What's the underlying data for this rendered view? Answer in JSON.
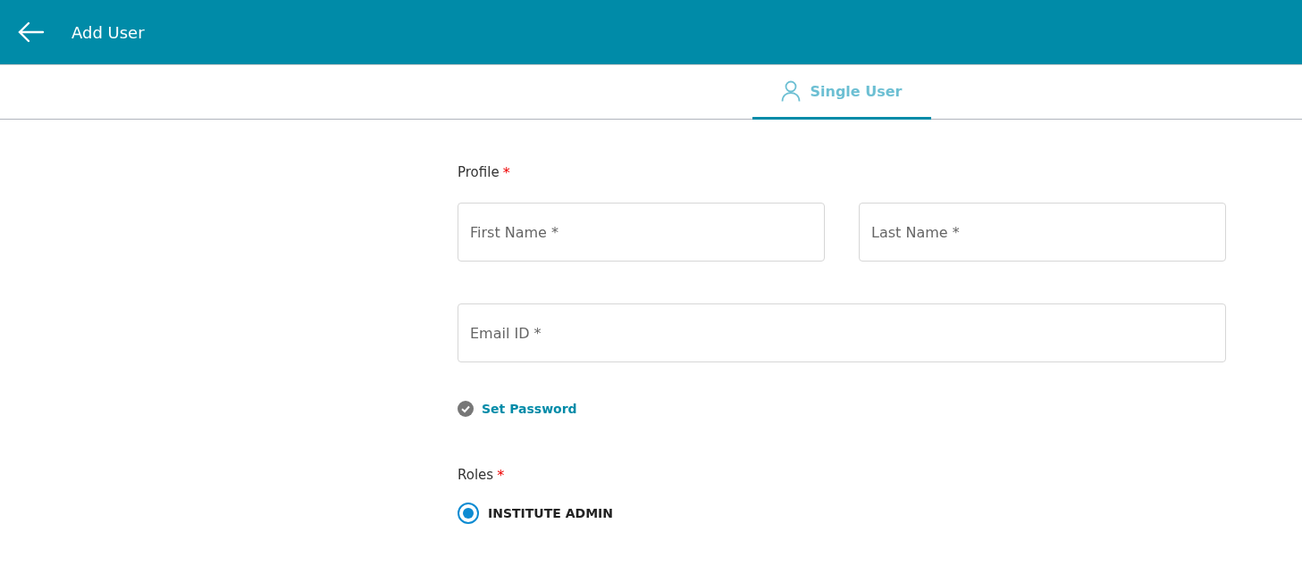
{
  "header": {
    "title": "Add User"
  },
  "tabs": [
    {
      "label": "Single User",
      "selected": true
    }
  ],
  "profile": {
    "label": "Profile",
    "required_mark": "*",
    "fields": [
      {
        "placeholder": "First Name *"
      },
      {
        "placeholder": "Last Name *"
      },
      {
        "placeholder": "Email ID *"
      }
    ]
  },
  "set_password": {
    "label": "Set Password"
  },
  "roles": {
    "label": "Roles",
    "required_mark": "*",
    "options": [
      {
        "label": "INSTITUTE ADMIN",
        "selected": true
      }
    ]
  }
}
